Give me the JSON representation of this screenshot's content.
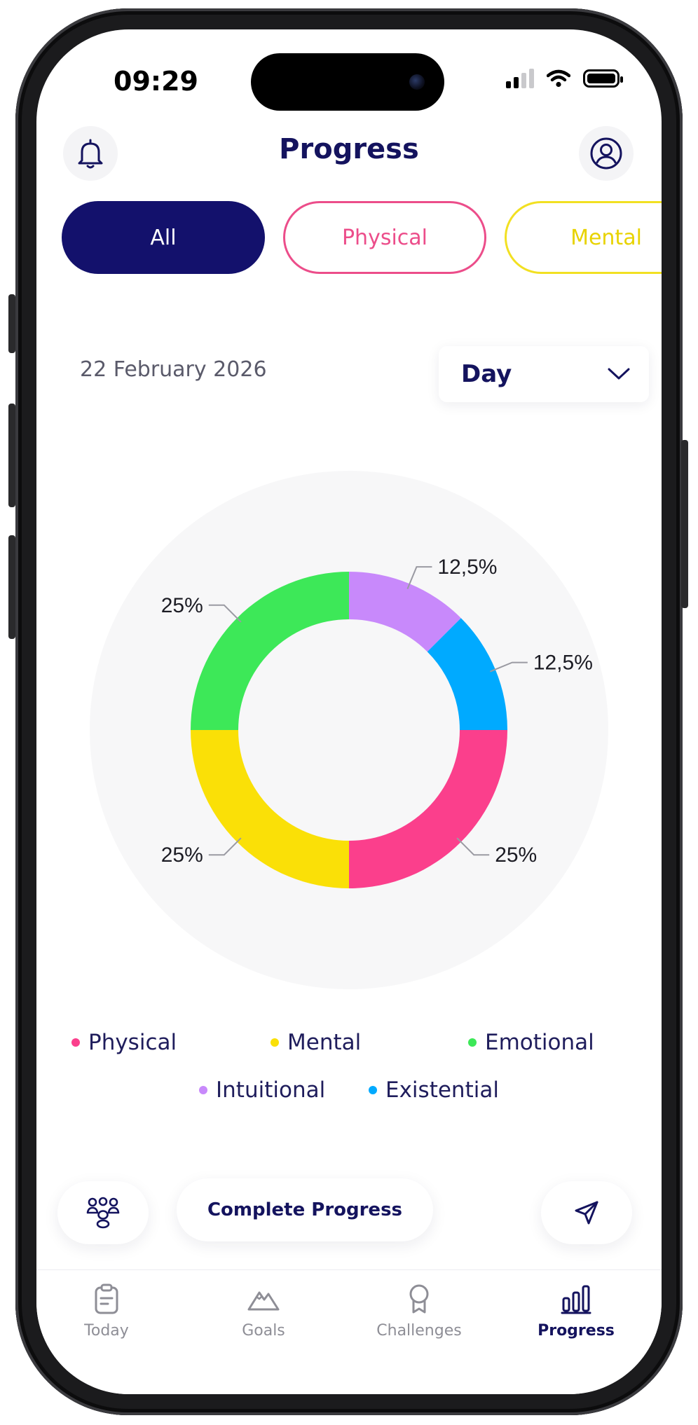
{
  "status_bar": {
    "time": "09:29"
  },
  "header": {
    "title": "Progress",
    "notification_icon": "bell-icon",
    "profile_icon": "user-circle-icon"
  },
  "filters": [
    {
      "label": "All",
      "active": true,
      "color": "#13116c"
    },
    {
      "label": "Physical",
      "active": false,
      "color": "#ec4d8a"
    },
    {
      "label": "Mental",
      "active": false,
      "color": "#f2e022"
    }
  ],
  "date_selector": {
    "date": "22 February 2026",
    "period": "Day"
  },
  "chart_data": {
    "type": "pie",
    "categories": [
      "Intuitional",
      "Existential",
      "Physical",
      "Mental",
      "Emotional"
    ],
    "values": [
      12.5,
      12.5,
      25,
      25,
      25
    ],
    "labels": [
      "12,5%",
      "12,5%",
      "25%",
      "25%",
      "25%"
    ],
    "colors": [
      "#c889fb",
      "#00aaff",
      "#fb3f8c",
      "#fae007",
      "#3de858"
    ],
    "donut": true,
    "legend_position": "bottom"
  },
  "legend": [
    {
      "label": "Physical",
      "color": "#fb3f8c"
    },
    {
      "label": "Mental",
      "color": "#fae007"
    },
    {
      "label": "Emotional",
      "color": "#3de858"
    },
    {
      "label": "Intuitional",
      "color": "#c889fb"
    },
    {
      "label": "Existential",
      "color": "#00aaff"
    }
  ],
  "actions": {
    "community_icon": "group-icon",
    "complete_label": "Complete Progress",
    "share_icon": "send-icon"
  },
  "tabbar": {
    "items": [
      {
        "label": "Today",
        "icon": "clipboard-icon",
        "active": false
      },
      {
        "label": "Goals",
        "icon": "mountain-icon",
        "active": false
      },
      {
        "label": "Challenges",
        "icon": "award-icon",
        "active": false
      },
      {
        "label": "Progress",
        "icon": "bar-chart-icon",
        "active": true
      }
    ]
  },
  "colors": {
    "primary": "#14135e",
    "accent_dark": "#13116c",
    "muted": "#8e8e96"
  }
}
